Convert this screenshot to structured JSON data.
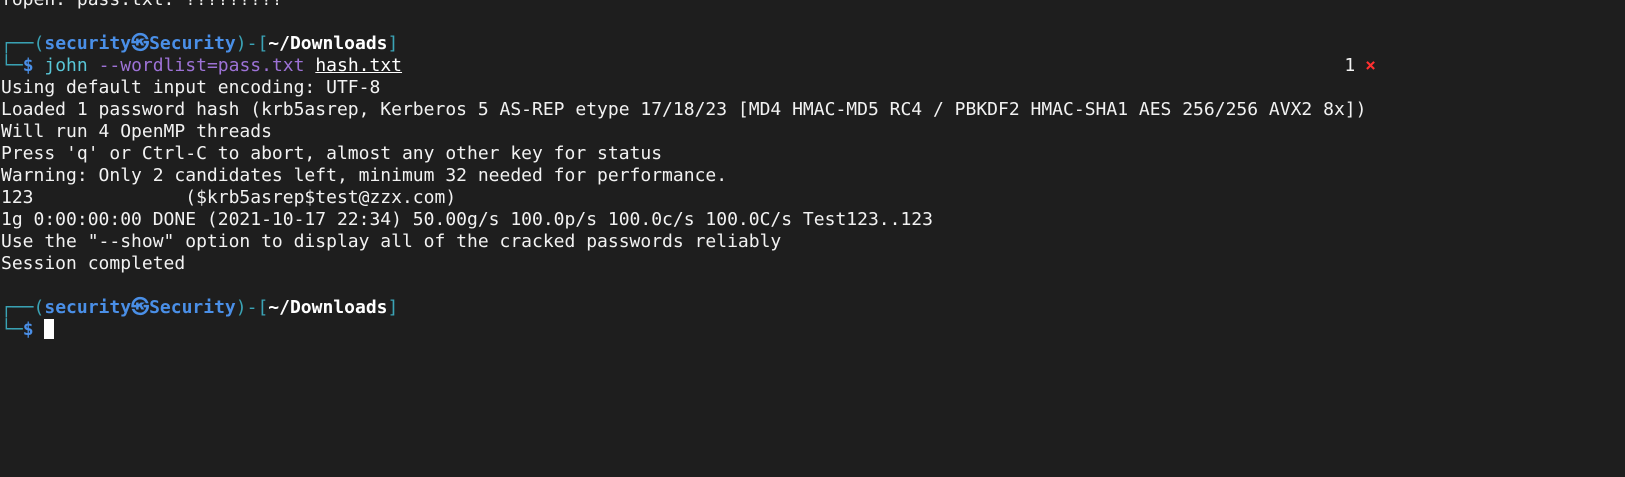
{
  "prev_output": "fopen: pass.txt: ?????????",
  "prompt": {
    "open": "┌──(",
    "user": "security",
    "at_symbol": "㉿",
    "host": "Security",
    "mid": ")-[",
    "path": "~/Downloads",
    "close": "]",
    "line2_prefix": "└─",
    "dollar": "$"
  },
  "command": {
    "program": "john",
    "option": "--wordlist=pass.txt",
    "target": "hash.txt"
  },
  "status": {
    "count": "1",
    "error_mark": "×"
  },
  "output": [
    "Using default input encoding: UTF-8",
    "Loaded 1 password hash (krb5asrep, Kerberos 5 AS-REP etype 17/18/23 [MD4 HMAC-MD5 RC4 / PBKDF2 HMAC-SHA1 AES 256/256 AVX2 8x])",
    "Will run 4 OpenMP threads",
    "Press 'q' or Ctrl-C to abort, almost any other key for status",
    "Warning: Only 2 candidates left, minimum 32 needed for performance.",
    "123              ($krb5asrep$test@zzx.com)",
    "1g 0:00:00:00 DONE (2021-10-17 22:34) 50.00g/s 100.0p/s 100.0c/s 100.0C/s Test123..123",
    "Use the \"--show\" option to display all of the cracked passwords reliably",
    "Session completed"
  ]
}
